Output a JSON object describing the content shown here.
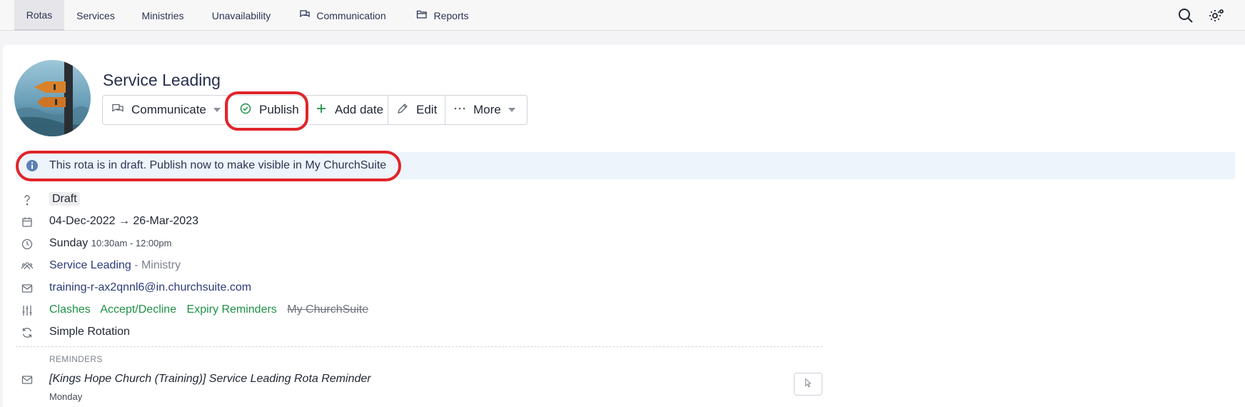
{
  "nav": {
    "tabs": [
      {
        "label": "Rotas"
      },
      {
        "label": "Services"
      },
      {
        "label": "Ministries"
      },
      {
        "label": "Unavailability"
      },
      {
        "label": "Communication",
        "icon": "chat-icon"
      },
      {
        "label": "Reports",
        "icon": "folder-icon"
      }
    ],
    "active_tab": "Rotas",
    "right_icons": [
      "search-icon",
      "gear-icon"
    ]
  },
  "rota": {
    "title": "Service Leading",
    "toolbar": {
      "communicate": "Communicate",
      "publish": "Publish",
      "add_date": "Add date",
      "edit": "Edit",
      "more": "More"
    },
    "banner": "This rota is in draft. Publish now to make visible in My ChurchSuite",
    "status": "Draft",
    "date_range": "04-Dec-2022 → 26-Mar-2023",
    "day": "Sunday",
    "time": "10:30am - 12:00pm",
    "ministry_name": "Service Leading",
    "ministry_suffix": " - Ministry",
    "email": "training-r-ax2qnnl6@in.churchsuite.com",
    "settings": {
      "clashes": "Clashes",
      "accept_decline": "Accept/Decline",
      "expiry_reminders": "Expiry Reminders",
      "my_churchsuite": "My ChurchSuite"
    },
    "rotation": "Simple Rotation",
    "reminders": {
      "heading": "REMINDERS",
      "title": "[Kings Hope Church (Training)] Service Leading Rota Reminder",
      "day": "Monday"
    }
  },
  "colors": {
    "accent_green": "#1e9146",
    "highlight_red": "#e0252a",
    "link_navy": "#2c3a7a",
    "banner_bg": "#eef4fb"
  }
}
